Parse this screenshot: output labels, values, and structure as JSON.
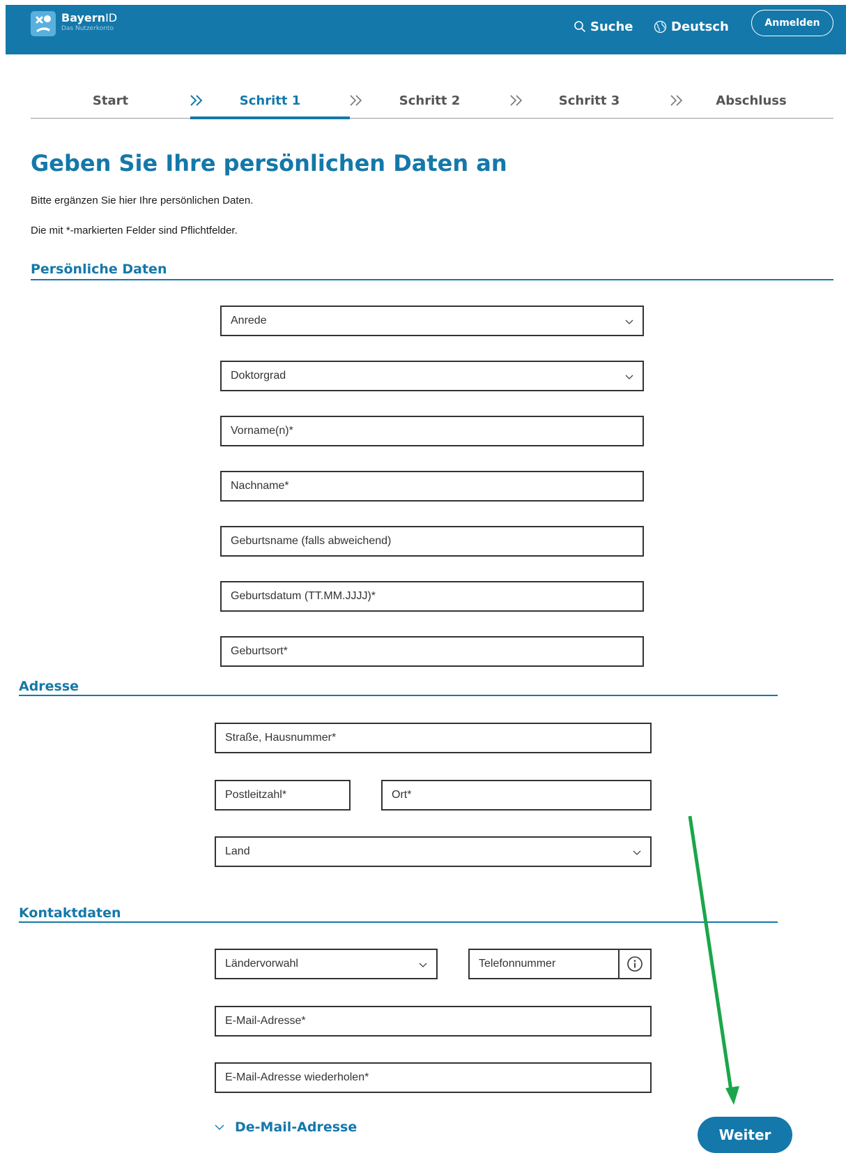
{
  "header": {
    "brand_name": "Bayern",
    "brand_suffix": "ID",
    "brand_subtitle": "Das Nutzerkonto",
    "search_label": "Suche",
    "language_label": "Deutsch",
    "login_label": "Anmelden",
    "background_color": "#1478aa"
  },
  "steps": [
    {
      "label": "Start",
      "active": false
    },
    {
      "label": "Schritt 1",
      "active": true
    },
    {
      "label": "Schritt 2",
      "active": false
    },
    {
      "label": "Schritt 3",
      "active": false
    },
    {
      "label": "Abschluss",
      "active": false
    }
  ],
  "page": {
    "title": "Geben Sie Ihre persönlichen Daten an",
    "intro": "Bitte ergänzen Sie hier Ihre persönlichen Daten.",
    "required_note": "Die mit *-markierten Felder sind Pflichtfelder.",
    "accent_color": "#1478aa"
  },
  "sections": {
    "personal": {
      "title": "Persönliche Daten",
      "fields": {
        "salutation": "Anrede",
        "doctor_degree": "Doktorgrad",
        "first_name": "Vorname(n)*",
        "last_name": "Nachname*",
        "birth_name": "Geburtsname (falls abweichend)",
        "birth_date": "Geburtsdatum (TT.MM.JJJJ)*",
        "birth_place": "Geburtsort*"
      }
    },
    "address": {
      "title": "Adresse",
      "fields": {
        "street": "Straße, Hausnummer*",
        "postal_code": "Postleitzahl*",
        "city": "Ort*",
        "country": "Land"
      }
    },
    "contact": {
      "title": "Kontaktdaten",
      "fields": {
        "country_code": "Ländervorwahl",
        "phone": "Telefonnummer",
        "email": "E-Mail-Adresse*",
        "email_repeat": "E-Mail-Adresse wiederholen*"
      },
      "demail_label": "De-Mail-Adresse"
    }
  },
  "actions": {
    "next_label": "Weiter"
  },
  "annotation": {
    "arrow_color": "#1aa64a"
  }
}
